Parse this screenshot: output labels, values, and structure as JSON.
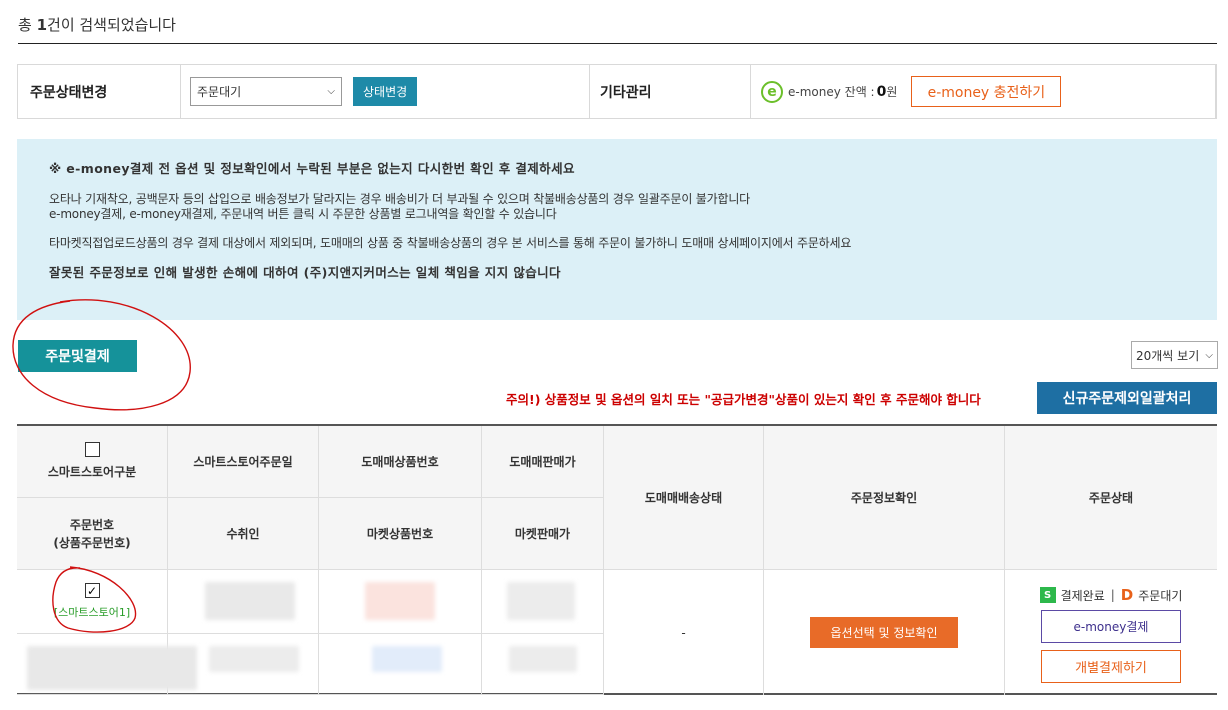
{
  "result": {
    "prefix": "총 ",
    "count": "1",
    "suffix": "건이 검색되었습니다"
  },
  "status_bar": {
    "change_label": "주문상태변경",
    "select_value": "주문대기",
    "change_button": "상태변경",
    "etc_label": "기타관리",
    "emoney_icon": "e",
    "emoney_balance_label": "e-money 잔액 : ",
    "emoney_amount": "0",
    "emoney_unit": "원",
    "charge_button": "e-money 충전하기"
  },
  "notice": {
    "line1": "※ e-money결제 전 옵션 및 정보확인에서 누락된 부분은 없는지 다시한번 확인 후 결제하세요",
    "line2": "오타나 기재착오, 공백문자 등의 삽입으로 배송정보가 달라지는 경우 배송비가 더 부과될 수 있으며 착불배송상품의 경우 일괄주문이 불가합니다",
    "line3": "e-money결제, e-money재결제, 주문내역 버튼 클릭 시 주문한 상품별 로그내역을 확인할 수 있습니다",
    "line4": "타마켓직접업로드상품의 경우 결제 대상에서 제외되며, 도매매의 상품 중 착불배송상품의 경우 본 서비스를 통해 주문이 불가하니 도매매 상세페이지에서 주문하세요",
    "line5": "잘못된 주문정보로 인해 발생한 손해에 대하여 (주)지앤지커머스는 일체 책임을 지지 않습니다"
  },
  "actions": {
    "order_pay_button": "주문및결제",
    "per_page": "20개씩 보기",
    "warning": "주의!) 상품정보 및 옵션의 일치 또는 \"공급가변경\"상품이 있는지 확인 후 주문해야 합니다",
    "bulk_button": "신규주문제외일괄처리"
  },
  "table": {
    "headers": {
      "store_type": "스마트스토어구분",
      "order_date": "스마트스토어주문일",
      "dome_product_no": "도매매상품번호",
      "dome_price": "도매매판매가",
      "dome_shipping": "도매매배송상태",
      "order_info": "주문정보확인",
      "order_status": "주문상태",
      "order_no_line1": "주문번호",
      "order_no_line2": "(상품주문번호)",
      "recipient": "수취인",
      "market_product_no": "마켓상품번호",
      "market_price": "마켓판매가"
    },
    "row": {
      "store_tag": "[스마트스토어1]",
      "checked_mark": "✓",
      "shipping_status": "-",
      "option_button": "옵션선택 및 정보확인",
      "payment_status": "결제완료",
      "order_status": "주문대기",
      "emoney_pay_button": "e-money결제",
      "individual_pay_button": "개별결제하기",
      "s_badge": "S",
      "d_badge": "D"
    }
  }
}
